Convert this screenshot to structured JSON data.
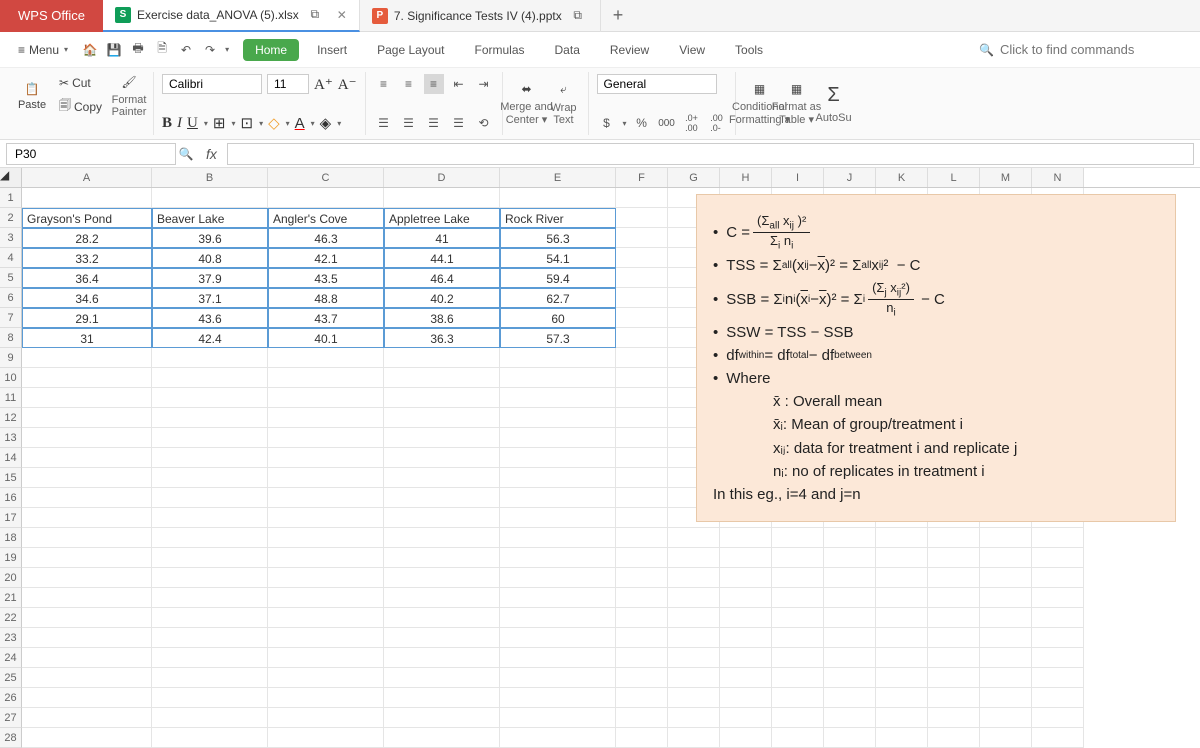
{
  "title_bar": {
    "brand": "WPS Office",
    "tabs": [
      {
        "icon": "S",
        "label": "Exercise data_ANOVA (5).xlsx",
        "active": true,
        "closable": true,
        "icon_class": "xls"
      },
      {
        "icon": "P",
        "label": "7. Significance Tests IV (4).pptx",
        "active": false,
        "closable": false,
        "icon_class": "ppt"
      }
    ]
  },
  "toolbar": {
    "menu_label": "Menu",
    "search_placeholder": "Click to find commands"
  },
  "ribbon_tabs": [
    "Home",
    "Insert",
    "Page Layout",
    "Formulas",
    "Data",
    "Review",
    "View",
    "Tools"
  ],
  "ribbon_active": "Home",
  "clipboard": {
    "paste": "Paste",
    "cut": "Cut",
    "copy": "Copy",
    "format_painter": "Format\nPainter"
  },
  "font": {
    "name": "Calibri",
    "size": "11"
  },
  "alignment": {
    "merge": "Merge and\nCenter",
    "wrap": "Wrap\nText"
  },
  "number": {
    "format": "General"
  },
  "styles": {
    "cond": "Conditional\nFormatting",
    "table": "Format as\nTable",
    "autosum": "AutoSu"
  },
  "namebox": "P30",
  "columns": [
    "A",
    "B",
    "C",
    "D",
    "E",
    "F",
    "G",
    "H",
    "I",
    "J",
    "K",
    "L",
    "M",
    "N"
  ],
  "chart_data": {
    "type": "table",
    "headers": [
      "Grayson's Pond",
      "Beaver Lake",
      "Angler's Cove",
      "Appletree Lake",
      "Rock River"
    ],
    "rows": [
      [
        28.2,
        39.6,
        46.3,
        41,
        56.3
      ],
      [
        33.2,
        40.8,
        42.1,
        44.1,
        54.1
      ],
      [
        36.4,
        37.9,
        43.5,
        46.4,
        59.4
      ],
      [
        34.6,
        37.1,
        48.8,
        40.2,
        62.7
      ],
      [
        29.1,
        43.6,
        43.7,
        38.6,
        60
      ],
      [
        31,
        42.4,
        40.1,
        36.3,
        57.3
      ]
    ]
  },
  "formulas": {
    "c": "C =",
    "tss": "TSS = Σ",
    "ssb": "SSB =  Σ",
    "ssw": "SSW = TSS − SSB",
    "df": "df",
    "df_within": "within",
    "df_eq": " = df",
    "df_total": "total",
    "df_minus": " − df",
    "df_between": "between",
    "where": "Where",
    "xbar": "x̄ : Overall mean",
    "xbari": "x̄ᵢ: Mean of group/treatment i",
    "xij": "xᵢⱼ: data for treatment i and replicate j",
    "ni": "nᵢ: no of replicates in treatment i",
    "footer": "In this eg., i=4 and j=n"
  }
}
